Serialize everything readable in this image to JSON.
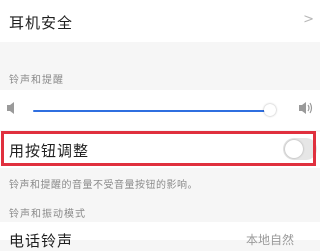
{
  "earphone_safety": {
    "label": "耳机安全",
    "chevron": ">"
  },
  "ringtone_section": {
    "label": "铃声和提醒"
  },
  "volume": {
    "level": 0.96,
    "accent": "#2f6fe0"
  },
  "adjust_with_buttons": {
    "label": "用按钮调整",
    "enabled": false,
    "highlight_color": "#e0303e"
  },
  "adjust_description": "铃声和提醒的音量不受音量按钮的影响。",
  "vibration_section": {
    "label": "铃声和振动模式"
  },
  "phone_ringtone": {
    "label": "电话铃声",
    "value": "本地自然"
  }
}
